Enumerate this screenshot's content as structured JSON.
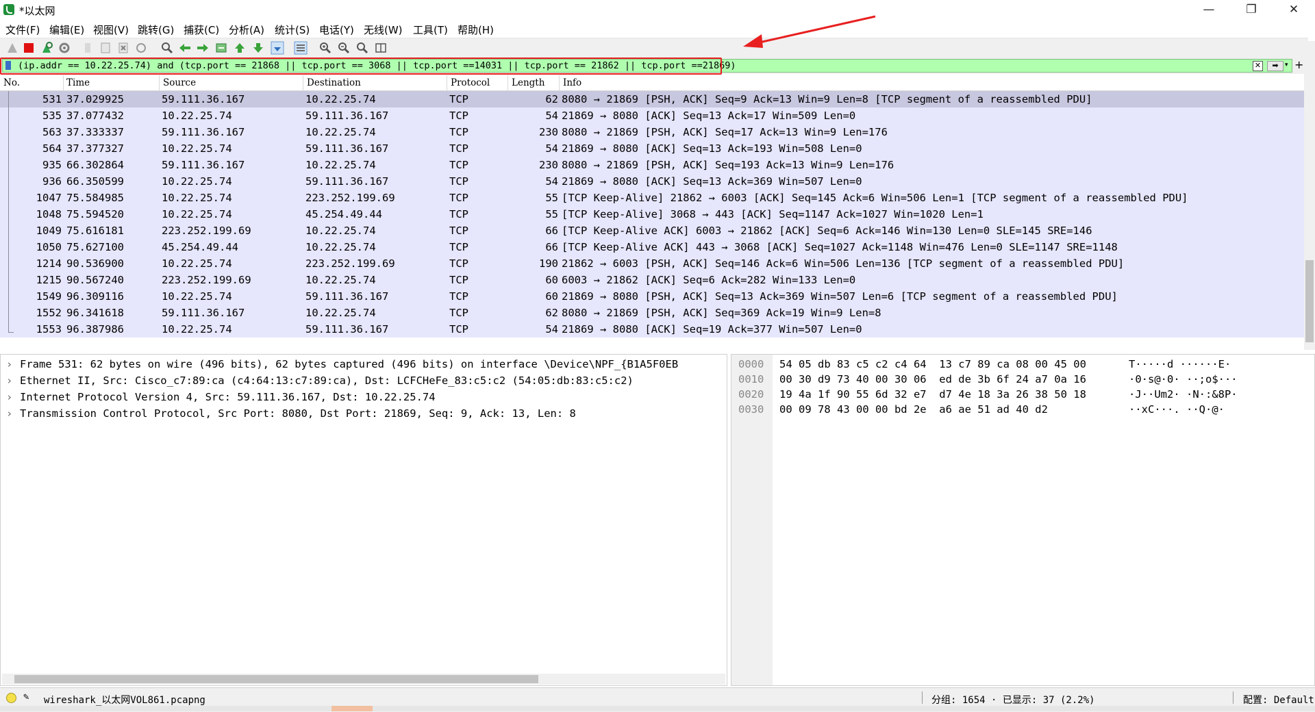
{
  "window": {
    "title": "*以太网",
    "minimize": "—",
    "restore": "❐",
    "close": "✕"
  },
  "menu": [
    "文件(F)",
    "编辑(E)",
    "视图(V)",
    "跳转(G)",
    "捕获(C)",
    "分析(A)",
    "统计(S)",
    "电话(Y)",
    "无线(W)",
    "工具(T)",
    "帮助(H)"
  ],
  "toolbar_icons": [
    "start-capture-icon",
    "stop-capture-icon",
    "restart-capture-icon",
    "capture-options-icon",
    "open-file-icon",
    "save-file-icon",
    "close-file-icon",
    "reload-file-icon",
    "find-packet-icon",
    "go-back-icon",
    "go-forward-icon",
    "go-to-packet-icon",
    "go-first-icon",
    "go-last-icon",
    "autoscroll-icon",
    "colorize-icon",
    "zoom-in-icon",
    "zoom-out-icon",
    "zoom-normal-icon",
    "resize-columns-icon"
  ],
  "filter": {
    "text": "(ip.addr == 10.22.25.74) and (tcp.port == 21868 || tcp.port == 3068 || tcp.port ==14031 || tcp.port == 21862 || tcp.port ==21869)",
    "clear": "✕",
    "apply": "➡",
    "dropdown": "▾",
    "add": "+"
  },
  "columns": [
    "No.",
    "Time",
    "Source",
    "Destination",
    "Protocol",
    "Length",
    "Info"
  ],
  "packets": [
    {
      "no": "531",
      "time": "37.029925",
      "src": "59.111.36.167",
      "dst": "10.22.25.74",
      "proto": "TCP",
      "len": "62",
      "info": "8080 → 21869 [PSH, ACK] Seq=9 Ack=13 Win=9 Len=8 [TCP segment of a reassembled PDU]"
    },
    {
      "no": "535",
      "time": "37.077432",
      "src": "10.22.25.74",
      "dst": "59.111.36.167",
      "proto": "TCP",
      "len": "54",
      "info": "21869 → 8080 [ACK] Seq=13 Ack=17 Win=509 Len=0"
    },
    {
      "no": "563",
      "time": "37.333337",
      "src": "59.111.36.167",
      "dst": "10.22.25.74",
      "proto": "TCP",
      "len": "230",
      "info": "8080 → 21869 [PSH, ACK] Seq=17 Ack=13 Win=9 Len=176"
    },
    {
      "no": "564",
      "time": "37.377327",
      "src": "10.22.25.74",
      "dst": "59.111.36.167",
      "proto": "TCP",
      "len": "54",
      "info": "21869 → 8080 [ACK] Seq=13 Ack=193 Win=508 Len=0"
    },
    {
      "no": "935",
      "time": "66.302864",
      "src": "59.111.36.167",
      "dst": "10.22.25.74",
      "proto": "TCP",
      "len": "230",
      "info": "8080 → 21869 [PSH, ACK] Seq=193 Ack=13 Win=9 Len=176"
    },
    {
      "no": "936",
      "time": "66.350599",
      "src": "10.22.25.74",
      "dst": "59.111.36.167",
      "proto": "TCP",
      "len": "54",
      "info": "21869 → 8080 [ACK] Seq=13 Ack=369 Win=507 Len=0"
    },
    {
      "no": "1047",
      "time": "75.584985",
      "src": "10.22.25.74",
      "dst": "223.252.199.69",
      "proto": "TCP",
      "len": "55",
      "info": "[TCP Keep-Alive] 21862 → 6003 [ACK] Seq=145 Ack=6 Win=506 Len=1 [TCP segment of a reassembled PDU]"
    },
    {
      "no": "1048",
      "time": "75.594520",
      "src": "10.22.25.74",
      "dst": "45.254.49.44",
      "proto": "TCP",
      "len": "55",
      "info": "[TCP Keep-Alive] 3068 → 443 [ACK] Seq=1147 Ack=1027 Win=1020 Len=1"
    },
    {
      "no": "1049",
      "time": "75.616181",
      "src": "223.252.199.69",
      "dst": "10.22.25.74",
      "proto": "TCP",
      "len": "66",
      "info": "[TCP Keep-Alive ACK] 6003 → 21862 [ACK] Seq=6 Ack=146 Win=130 Len=0 SLE=145 SRE=146"
    },
    {
      "no": "1050",
      "time": "75.627100",
      "src": "45.254.49.44",
      "dst": "10.22.25.74",
      "proto": "TCP",
      "len": "66",
      "info": "[TCP Keep-Alive ACK] 443 → 3068 [ACK] Seq=1027 Ack=1148 Win=476 Len=0 SLE=1147 SRE=1148"
    },
    {
      "no": "1214",
      "time": "90.536900",
      "src": "10.22.25.74",
      "dst": "223.252.199.69",
      "proto": "TCP",
      "len": "190",
      "info": "21862 → 6003 [PSH, ACK] Seq=146 Ack=6 Win=506 Len=136 [TCP segment of a reassembled PDU]"
    },
    {
      "no": "1215",
      "time": "90.567240",
      "src": "223.252.199.69",
      "dst": "10.22.25.74",
      "proto": "TCP",
      "len": "60",
      "info": "6003 → 21862 [ACK] Seq=6 Ack=282 Win=133 Len=0"
    },
    {
      "no": "1549",
      "time": "96.309116",
      "src": "10.22.25.74",
      "dst": "59.111.36.167",
      "proto": "TCP",
      "len": "60",
      "info": "21869 → 8080 [PSH, ACK] Seq=13 Ack=369 Win=507 Len=6 [TCP segment of a reassembled PDU]"
    },
    {
      "no": "1552",
      "time": "96.341618",
      "src": "59.111.36.167",
      "dst": "10.22.25.74",
      "proto": "TCP",
      "len": "62",
      "info": "8080 → 21869 [PSH, ACK] Seq=369 Ack=19 Win=9 Len=8"
    },
    {
      "no": "1553",
      "time": "96.387986",
      "src": "10.22.25.74",
      "dst": "59.111.36.167",
      "proto": "TCP",
      "len": "54",
      "info": "21869 → 8080 [ACK] Seq=19 Ack=377 Win=507 Len=0"
    }
  ],
  "details": [
    "Frame 531: 62 bytes on wire (496 bits), 62 bytes captured (496 bits) on interface \\Device\\NPF_{B1A5F0EB",
    "Ethernet II, Src: Cisco_c7:89:ca (c4:64:13:c7:89:ca), Dst: LCFCHeFe_83:c5:c2 (54:05:db:83:c5:c2)",
    "Internet Protocol Version 4, Src: 59.111.36.167, Dst: 10.22.25.74",
    "Transmission Control Protocol, Src Port: 8080, Dst Port: 21869, Seq: 9, Ack: 13, Len: 8"
  ],
  "bytes": [
    {
      "offset": "0000",
      "hex": "54 05 db 83 c5 c2 c4 64  13 c7 89 ca 08 00 45 00",
      "ascii": "T·····d ······E·"
    },
    {
      "offset": "0010",
      "hex": "00 30 d9 73 40 00 30 06  ed de 3b 6f 24 a7 0a 16",
      "ascii": "·0·s@·0· ··;o$···"
    },
    {
      "offset": "0020",
      "hex": "19 4a 1f 90 55 6d 32 e7  d7 4e 18 3a 26 38 50 18",
      "ascii": "·J··Um2· ·N·:&8P·"
    },
    {
      "offset": "0030",
      "hex": "00 09 78 43 00 00 bd 2e  a6 ae 51 ad 40 d2",
      "ascii": "··xC···. ··Q·@·"
    }
  ],
  "status": {
    "file": "wireshark_以太网VOL861.pcapng",
    "stats": "分组: 1654 · 已显示: 37 (2.2%)",
    "profile": "配置: Default"
  },
  "colors": {
    "filter_bg": "#afffaf",
    "row_bg": "#e6e6fc",
    "selected_row_bg": "#c7c7e0",
    "annotation": "#e82020"
  }
}
